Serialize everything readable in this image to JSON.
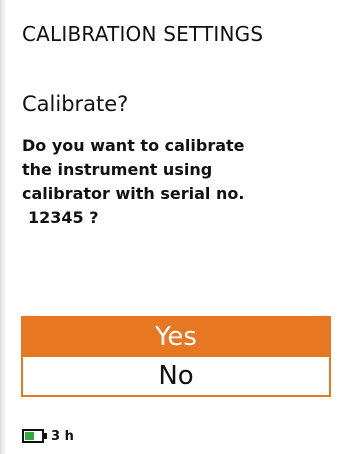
{
  "header": {
    "title": "CALIBRATION SETTINGS"
  },
  "dialog": {
    "title": "Calibrate?",
    "message_lines": [
      "Do you want to calibrate",
      "the instrument using",
      "calibrator with serial no.",
      "12345 ?"
    ]
  },
  "options": [
    {
      "label": "Yes",
      "selected": true
    },
    {
      "label": "No",
      "selected": false
    }
  ],
  "status": {
    "battery_level": 0.55,
    "battery_time": "3 h"
  },
  "colors": {
    "accent": "#e87722",
    "battery_fill": "#2eaa3f"
  },
  "icons": [
    "battery-icon"
  ]
}
